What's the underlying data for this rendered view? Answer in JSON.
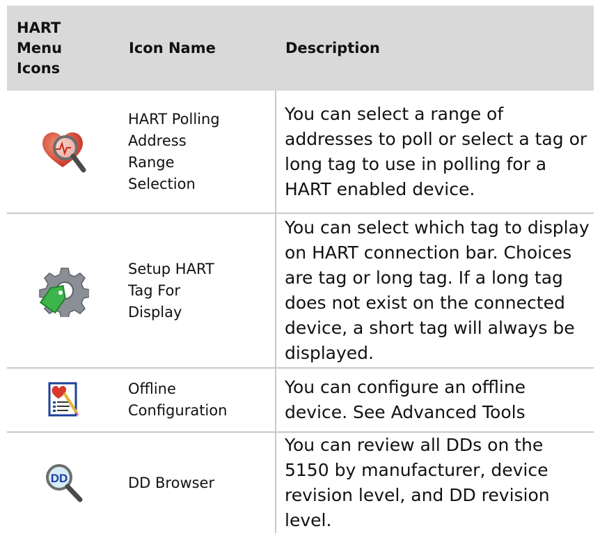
{
  "table": {
    "headers": {
      "icon": "HART\nMenu\nIcons",
      "name": "Icon Name",
      "description": "Description"
    },
    "rows": [
      {
        "icon": "heart-magnifier-icon",
        "name": "HART Polling\nAddress\nRange\nSelection",
        "description": "You can select a range of addresses to poll or select a tag or long tag to use in polling for a HART enabled device."
      },
      {
        "icon": "gear-tag-icon",
        "name": "Setup HART\nTag For\nDisplay",
        "description": "You can select which tag to display on HART connection bar. Choices are tag or long tag. If a long tag does not exist on the connected device, a short tag will always be displayed."
      },
      {
        "icon": "document-heart-pencil-icon",
        "name": "Offline\nConfiguration",
        "description": "You can configure an offline device. See Advanced Tools"
      },
      {
        "icon": "dd-magnifier-icon",
        "name": "DD Browser",
        "description": "You can review all DDs on the 5150 by manufacturer, device revision level, and DD revision level."
      }
    ]
  },
  "colors": {
    "header_bg": "#d9d9d9",
    "rule": "#c8c8c8",
    "heart_red": "#d9392b",
    "tag_green": "#3cb54a",
    "dd_blue": "#1c3f9a"
  }
}
